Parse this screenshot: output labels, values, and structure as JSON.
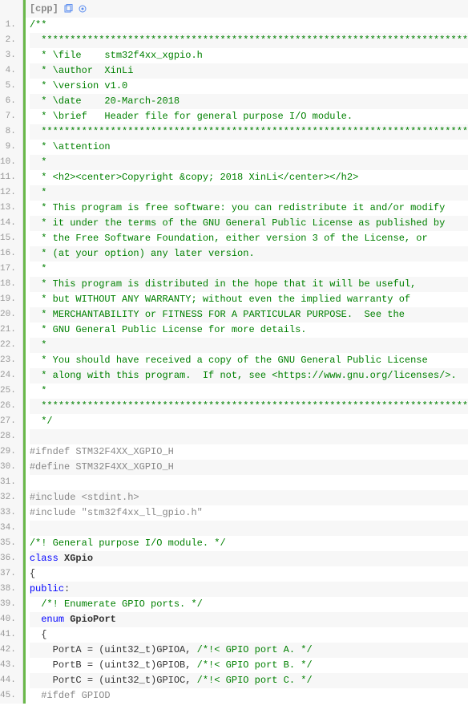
{
  "header": {
    "lang": "[cpp]",
    "icon1": "copy-icon",
    "icon2": "view-icon"
  },
  "lines": [
    {
      "n": "1.",
      "alt": false,
      "segs": [
        {
          "cls": "c-comment",
          "t": "/**"
        }
      ]
    },
    {
      "n": "2.",
      "alt": true,
      "segs": [
        {
          "cls": "c-comment",
          "t": "  ******************************************************************************"
        }
      ]
    },
    {
      "n": "3.",
      "alt": false,
      "segs": [
        {
          "cls": "c-comment",
          "t": "  * \\file    stm32f4xx_xgpio.h"
        }
      ]
    },
    {
      "n": "4.",
      "alt": true,
      "segs": [
        {
          "cls": "c-comment",
          "t": "  * \\author  XinLi"
        }
      ]
    },
    {
      "n": "5.",
      "alt": false,
      "segs": [
        {
          "cls": "c-comment",
          "t": "  * \\version v1.0"
        }
      ]
    },
    {
      "n": "6.",
      "alt": true,
      "segs": [
        {
          "cls": "c-comment",
          "t": "  * \\date    20-March-2018"
        }
      ]
    },
    {
      "n": "7.",
      "alt": false,
      "segs": [
        {
          "cls": "c-comment",
          "t": "  * \\brief   Header file for general purpose I/O module."
        }
      ]
    },
    {
      "n": "8.",
      "alt": true,
      "segs": [
        {
          "cls": "c-comment",
          "t": "  ******************************************************************************"
        }
      ]
    },
    {
      "n": "9.",
      "alt": false,
      "segs": [
        {
          "cls": "c-comment",
          "t": "  * \\attention"
        }
      ]
    },
    {
      "n": "10.",
      "alt": true,
      "segs": [
        {
          "cls": "c-comment",
          "t": "  *"
        }
      ]
    },
    {
      "n": "11.",
      "alt": false,
      "segs": [
        {
          "cls": "c-comment",
          "t": "  * <h2><center>Copyright &copy; 2018 XinLi</center></h2>"
        }
      ]
    },
    {
      "n": "12.",
      "alt": true,
      "segs": [
        {
          "cls": "c-comment",
          "t": "  *"
        }
      ]
    },
    {
      "n": "13.",
      "alt": false,
      "segs": [
        {
          "cls": "c-comment",
          "t": "  * This program is free software: you can redistribute it and/or modify"
        }
      ]
    },
    {
      "n": "14.",
      "alt": true,
      "segs": [
        {
          "cls": "c-comment",
          "t": "  * it under the terms of the GNU General Public License as published by"
        }
      ]
    },
    {
      "n": "15.",
      "alt": false,
      "segs": [
        {
          "cls": "c-comment",
          "t": "  * the Free Software Foundation, either version 3 of the License, or"
        }
      ]
    },
    {
      "n": "16.",
      "alt": true,
      "segs": [
        {
          "cls": "c-comment",
          "t": "  * (at your option) any later version."
        }
      ]
    },
    {
      "n": "17.",
      "alt": false,
      "segs": [
        {
          "cls": "c-comment",
          "t": "  *"
        }
      ]
    },
    {
      "n": "18.",
      "alt": true,
      "segs": [
        {
          "cls": "c-comment",
          "t": "  * This program is distributed in the hope that it will be useful,"
        }
      ]
    },
    {
      "n": "19.",
      "alt": false,
      "segs": [
        {
          "cls": "c-comment",
          "t": "  * but WITHOUT ANY WARRANTY; without even the implied warranty of"
        }
      ]
    },
    {
      "n": "20.",
      "alt": true,
      "segs": [
        {
          "cls": "c-comment",
          "t": "  * MERCHANTABILITY or FITNESS FOR A PARTICULAR PURPOSE.  See the"
        }
      ]
    },
    {
      "n": "21.",
      "alt": false,
      "segs": [
        {
          "cls": "c-comment",
          "t": "  * GNU General Public License for more details."
        }
      ]
    },
    {
      "n": "22.",
      "alt": true,
      "segs": [
        {
          "cls": "c-comment",
          "t": "  *"
        }
      ]
    },
    {
      "n": "23.",
      "alt": false,
      "segs": [
        {
          "cls": "c-comment",
          "t": "  * You should have received a copy of the GNU General Public License"
        }
      ]
    },
    {
      "n": "24.",
      "alt": true,
      "segs": [
        {
          "cls": "c-comment",
          "t": "  * along with this program.  If not, see <https://www.gnu.org/licenses/>."
        }
      ]
    },
    {
      "n": "25.",
      "alt": false,
      "segs": [
        {
          "cls": "c-comment",
          "t": "  *"
        }
      ]
    },
    {
      "n": "26.",
      "alt": true,
      "segs": [
        {
          "cls": "c-comment",
          "t": "  ******************************************************************************"
        }
      ]
    },
    {
      "n": "27.",
      "alt": false,
      "segs": [
        {
          "cls": "c-comment",
          "t": "  */"
        }
      ]
    },
    {
      "n": "28.",
      "alt": true,
      "segs": [
        {
          "cls": "",
          "t": " "
        }
      ]
    },
    {
      "n": "29.",
      "alt": false,
      "segs": [
        {
          "cls": "c-pp",
          "t": "#ifndef STM32F4XX_XGPIO_H"
        }
      ]
    },
    {
      "n": "30.",
      "alt": true,
      "segs": [
        {
          "cls": "c-pp",
          "t": "#define STM32F4XX_XGPIO_H"
        }
      ]
    },
    {
      "n": "31.",
      "alt": false,
      "segs": [
        {
          "cls": "",
          "t": " "
        }
      ]
    },
    {
      "n": "32.",
      "alt": true,
      "segs": [
        {
          "cls": "c-pp",
          "t": "#include <stdint.h>"
        }
      ]
    },
    {
      "n": "33.",
      "alt": false,
      "segs": [
        {
          "cls": "c-pp",
          "t": "#include \"stm32f4xx_ll_gpio.h\""
        }
      ]
    },
    {
      "n": "34.",
      "alt": true,
      "segs": [
        {
          "cls": "",
          "t": " "
        }
      ]
    },
    {
      "n": "35.",
      "alt": false,
      "segs": [
        {
          "cls": "c-comment",
          "t": "/*! General purpose I/O module. */"
        }
      ]
    },
    {
      "n": "36.",
      "alt": true,
      "segs": [
        {
          "cls": "c-kw",
          "t": "class"
        },
        {
          "cls": "",
          "t": " "
        },
        {
          "cls": "c-type",
          "t": "XGpio"
        }
      ]
    },
    {
      "n": "37.",
      "alt": false,
      "segs": [
        {
          "cls": "",
          "t": "{"
        }
      ]
    },
    {
      "n": "38.",
      "alt": true,
      "segs": [
        {
          "cls": "c-kw",
          "t": "public"
        },
        {
          "cls": "",
          "t": ":"
        }
      ]
    },
    {
      "n": "39.",
      "alt": false,
      "segs": [
        {
          "cls": "",
          "t": "  "
        },
        {
          "cls": "c-comment",
          "t": "/*! Enumerate GPIO ports. */"
        }
      ]
    },
    {
      "n": "40.",
      "alt": true,
      "segs": [
        {
          "cls": "",
          "t": "  "
        },
        {
          "cls": "c-kw",
          "t": "enum"
        },
        {
          "cls": "",
          "t": " "
        },
        {
          "cls": "c-type",
          "t": "GpioPort"
        }
      ]
    },
    {
      "n": "41.",
      "alt": false,
      "segs": [
        {
          "cls": "",
          "t": "  {"
        }
      ]
    },
    {
      "n": "42.",
      "alt": true,
      "segs": [
        {
          "cls": "",
          "t": "    PortA = (uint32_t)GPIOA, "
        },
        {
          "cls": "c-comment",
          "t": "/*!< GPIO port A. */"
        }
      ]
    },
    {
      "n": "43.",
      "alt": false,
      "segs": [
        {
          "cls": "",
          "t": "    PortB = (uint32_t)GPIOB, "
        },
        {
          "cls": "c-comment",
          "t": "/*!< GPIO port B. */"
        }
      ]
    },
    {
      "n": "44.",
      "alt": true,
      "segs": [
        {
          "cls": "",
          "t": "    PortC = (uint32_t)GPIOC, "
        },
        {
          "cls": "c-comment",
          "t": "/*!< GPIO port C. */"
        }
      ]
    },
    {
      "n": "45.",
      "alt": false,
      "segs": [
        {
          "cls": "",
          "t": "  "
        },
        {
          "cls": "c-pp",
          "t": "#ifdef GPIOD"
        }
      ]
    }
  ]
}
